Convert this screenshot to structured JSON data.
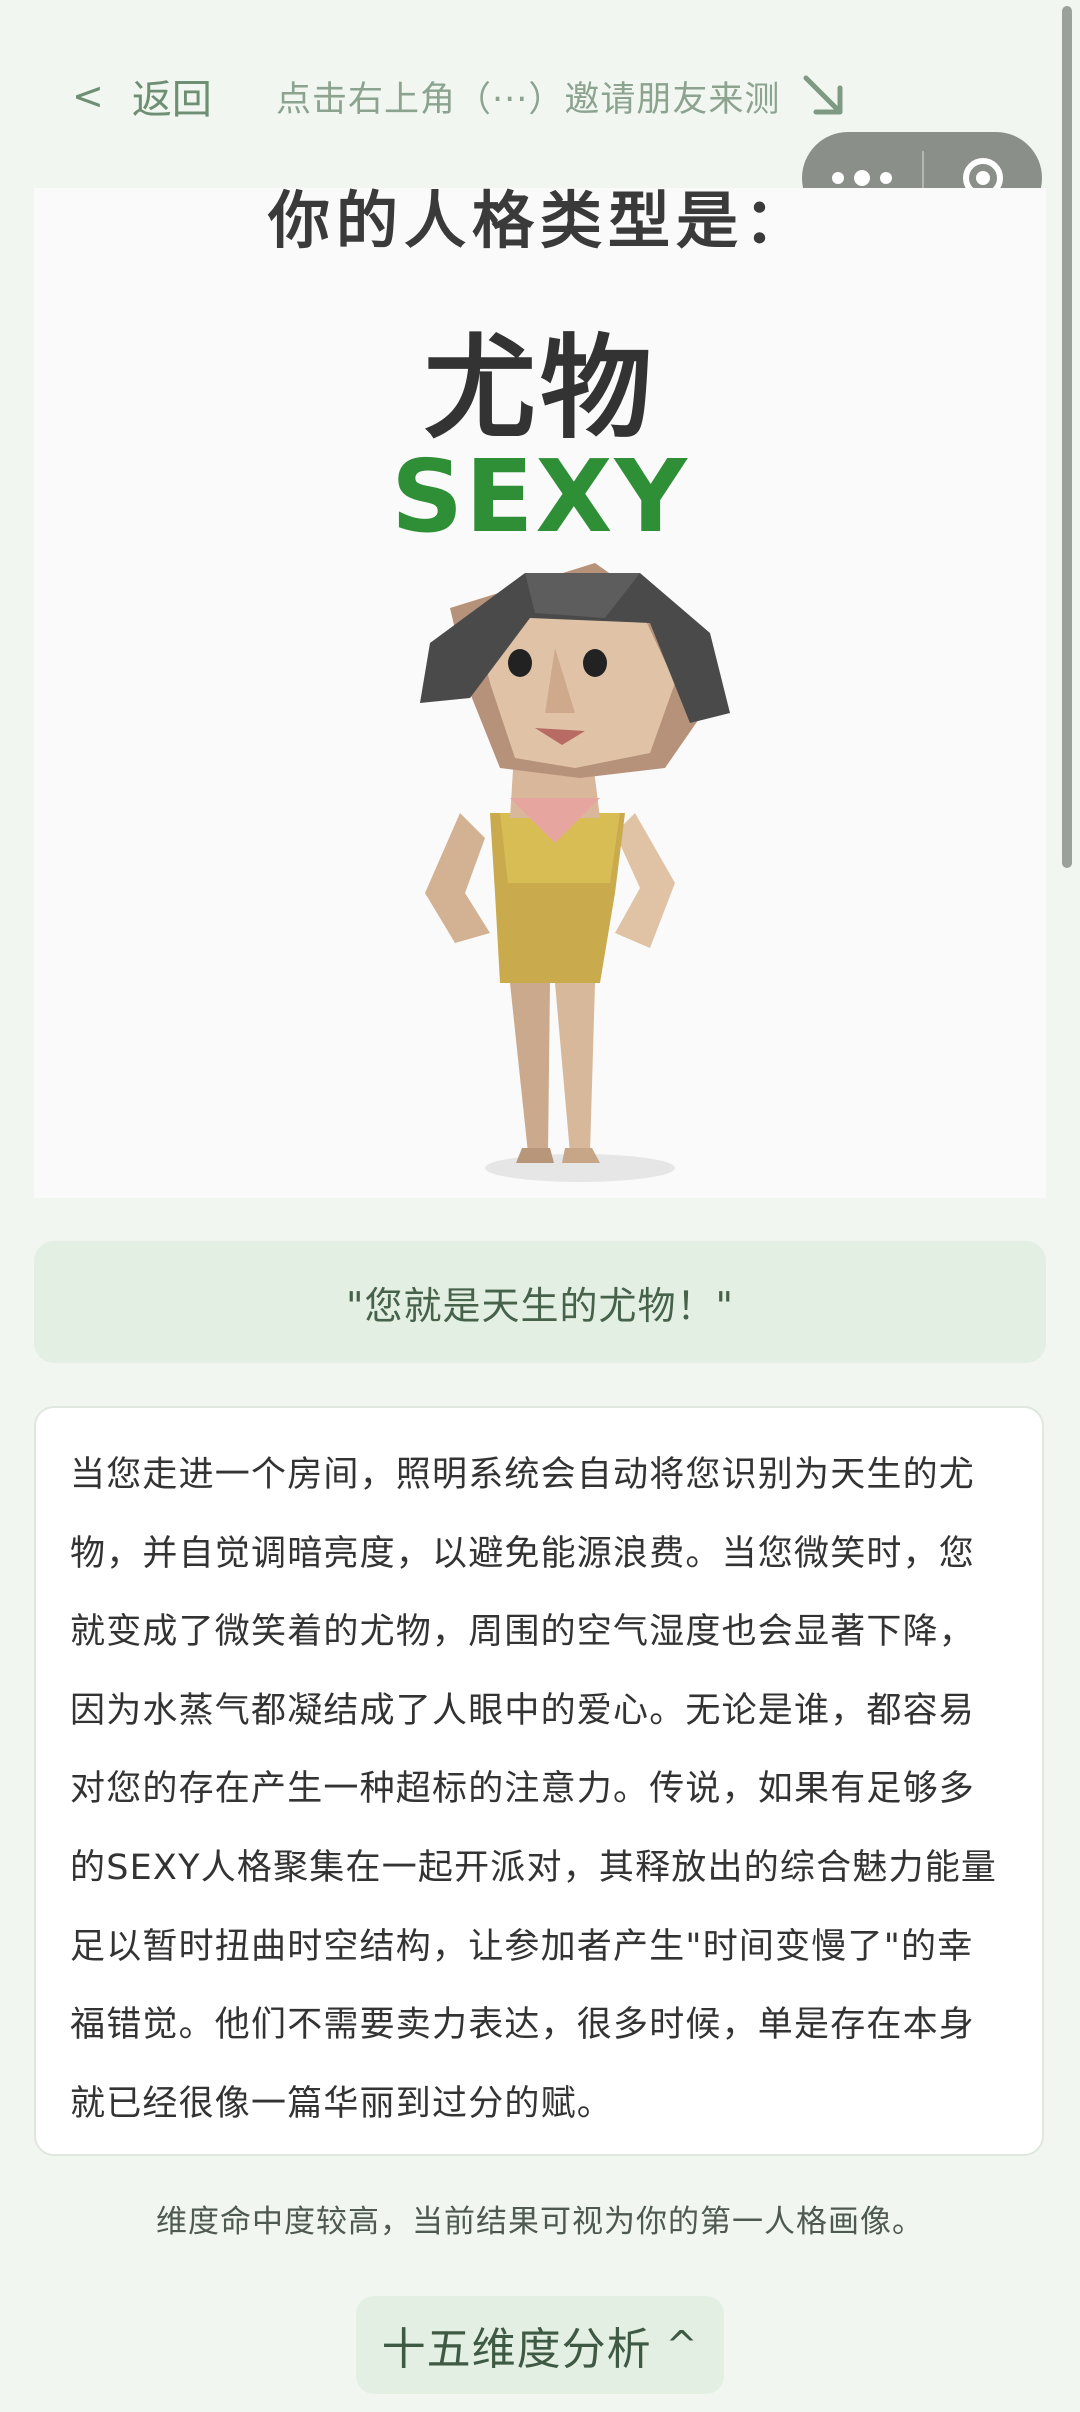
{
  "header": {
    "back_icon": "chevron-left-icon",
    "back_label": "< 返回",
    "back_text": "返回",
    "share_hint": "点击右上角（···）邀请朋友来测",
    "share_arrow_icon": "arrow-down-right-icon"
  },
  "capsule": {
    "more_icon": "more-dots-icon",
    "close_icon": "target-close-icon"
  },
  "result_image": {
    "top_text": "你的人格类型是：",
    "type_cn": "尤物",
    "type_en": "SEXY",
    "type_en_color": "#2f8f37"
  },
  "quote": "\"您就是天生的尤物！\"",
  "description": "当您走进一个房间，照明系统会自动将您识别为天生的尤物，并自觉调暗亮度，以避免能源浪费。当您微笑时，您就变成了微笑着的尤物，周围的空气湿度也会显著下降，因为水蒸气都凝结成了人眼中的爱心。无论是谁，都容易对您的存在产生一种超标的注意力。传说，如果有足够多的SEXY人格聚集在一起开派对，其释放出的综合魅力能量足以暂时扭曲时空结构，让参加者产生\"时间变慢了\"的幸福错觉。他们不需要卖力表达，很多时候，单是存在本身就已经很像一篇华丽到过分的赋。",
  "note": "维度命中度较高，当前结果可视为你的第一人格画像。",
  "analysis_button": {
    "label": "十五维度分析",
    "chevron": "^"
  },
  "colors": {
    "background": "#f1f6f1",
    "accent_green": "#2f8f37",
    "pill_bg": "#e3efe3"
  }
}
